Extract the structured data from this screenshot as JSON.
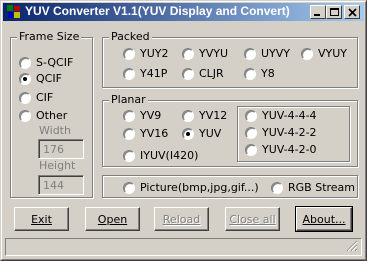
{
  "window": {
    "title": "YUV Converter V1.1(YUV Display and Convert)"
  },
  "title_buttons": {
    "minimize": "minimize",
    "maximize": "maximize",
    "close": "close"
  },
  "frame_size": {
    "label": "Frame Size",
    "options": [
      "S-QCIF",
      "QCIF",
      "CIF",
      "Other"
    ],
    "selected": "QCIF",
    "width_label": "Width",
    "width_value": "176",
    "height_label": "Height",
    "height_value": "144"
  },
  "packed": {
    "label": "Packed",
    "options": [
      "YUY2",
      "YVYU",
      "UYVY",
      "VYUY",
      "Y41P",
      "CLJR",
      "Y8"
    ]
  },
  "planar": {
    "label": "Planar",
    "options": [
      "YV9",
      "YV12",
      "YV16",
      "YUV",
      "IYUV(I420)"
    ],
    "selected": "YUV",
    "yuv_sub": [
      "YUV-4-4-4",
      "YUV-4-2-2",
      "YUV-4-2-0"
    ]
  },
  "source": {
    "picture": "Picture(bmp,jpg,gif...)",
    "rgb": "RGB Stream"
  },
  "buttons": {
    "exit": "Exit",
    "open": "Open",
    "reload": "Reload",
    "close_all": "Close all",
    "about": "About..."
  },
  "colors": {
    "title_gradient_start": "#0a246a",
    "title_gradient_end": "#a6caf0",
    "face": "#d4d0c8"
  }
}
